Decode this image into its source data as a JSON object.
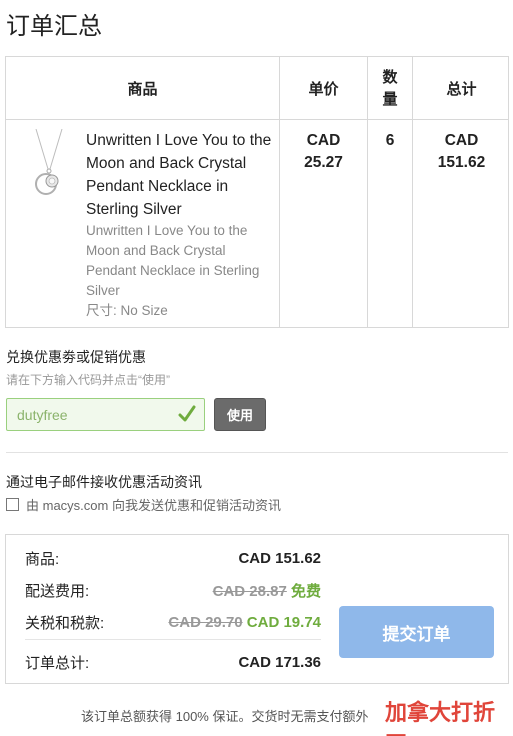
{
  "title": "订单汇总",
  "table": {
    "headers": {
      "product": "商品",
      "unit_price": "单价",
      "qty_line1": "数",
      "qty_line2": "量",
      "total": "总计"
    },
    "item": {
      "name": "Unwritten I Love You to the Moon and Back Crystal Pendant Necklace in Sterling Silver",
      "description": "Unwritten I Love You to the Moon and Back Crystal Pendant Necklace in Sterling Silver",
      "size": "尺寸: No Size",
      "unit_price_currency": "CAD",
      "unit_price_amount": "25.27",
      "quantity": "6",
      "total_currency": "CAD",
      "total_amount": "151.62"
    }
  },
  "coupon": {
    "title": "兑换优惠劵或促销优惠",
    "hint": "请在下方输入代码并点击“使用”",
    "code": "dutyfree",
    "apply_label": "使用"
  },
  "email": {
    "title": "通过电子邮件接收优惠活动资讯",
    "checkbox_label": "由 macys.com 向我发送优惠和促销活动资讯"
  },
  "summary": {
    "items_label": "商品:",
    "items_value": "CAD 151.62",
    "shipping_label": "配送费用:",
    "shipping_original": "CAD 28.87",
    "shipping_value": "免费",
    "tax_label": "关税和税款:",
    "tax_original": "CAD 29.70",
    "tax_value": "CAD 19.74",
    "total_label": "订单总计:",
    "total_value": "CAD 171.36",
    "submit_label": "提交订单"
  },
  "footer": "该订单总额获得 100% 保证。交货时无需支付额外",
  "watermark": "加拿大打折网",
  "colors": {
    "submit_button": "#8fb8ea",
    "accent_green": "#6fac3e",
    "watermark_red": "#e0453a"
  }
}
